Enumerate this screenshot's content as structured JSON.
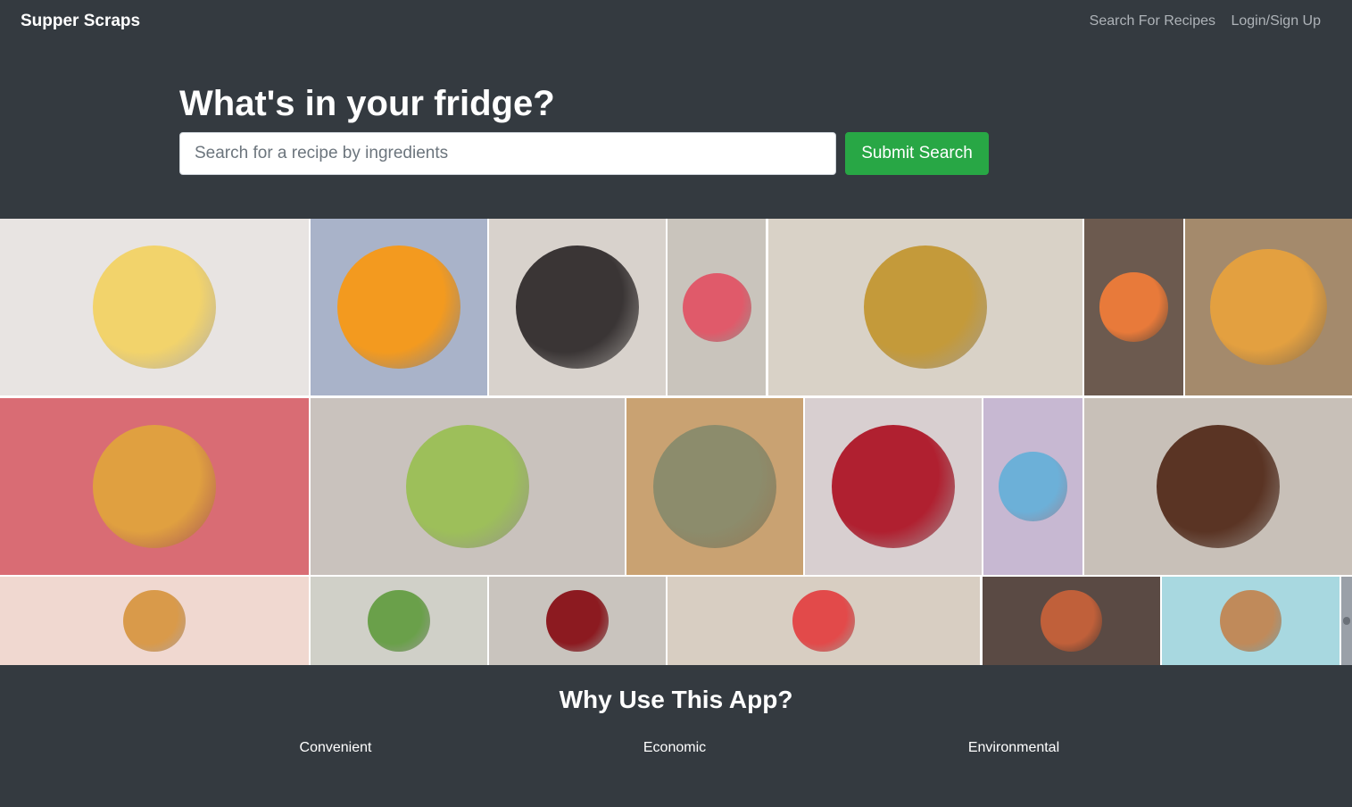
{
  "navbar": {
    "brand": "Supper Scraps",
    "links": [
      "Search For Recipes",
      "Login/Sign Up"
    ]
  },
  "hero": {
    "title": "What's in your fridge?",
    "search_placeholder": "Search for a recipe by ingredients",
    "submit_label": "Submit Search"
  },
  "gallery": {
    "photos": [
      {
        "name": "rainbow-cake-photo",
        "bg": "#e8e4e2",
        "accent": "#f2d36b"
      },
      {
        "name": "orange-cake-photo",
        "bg": "#a9b3c9",
        "accent": "#f39a1f"
      },
      {
        "name": "knots-photo",
        "bg": "#d8d2cc",
        "accent": "#3a3535"
      },
      {
        "name": "strawberry-cake-photo",
        "bg": "#c9c4bc",
        "accent": "#e05a6a"
      },
      {
        "name": "fries-photo",
        "bg": "#d9d2c7",
        "accent": "#c49a3a"
      },
      {
        "name": "cupcake-photo",
        "bg": "#6c5a4f",
        "accent": "#e87a3a"
      },
      {
        "name": "orange-tart-photo",
        "bg": "#a48a6c",
        "accent": "#e3a040"
      },
      {
        "name": "burger-photo",
        "bg": "#d96c74",
        "accent": "#e0a040"
      },
      {
        "name": "tacos-photo",
        "bg": "#c9c2bd",
        "accent": "#9dbf5a"
      },
      {
        "name": "roast-photo",
        "bg": "#c9a272",
        "accent": "#8c8c6c"
      },
      {
        "name": "red-velvet-photo",
        "bg": "#d8cfd0",
        "accent": "#b02030"
      },
      {
        "name": "cake-balls-photo",
        "bg": "#c7b8d2",
        "accent": "#6cb0d8"
      },
      {
        "name": "chocolate-muffins-photo",
        "bg": "#c8c0b8",
        "accent": "#5a3424"
      },
      {
        "name": "sliders-photo",
        "bg": "#f0d8d0",
        "accent": "#d99a4a"
      },
      {
        "name": "salad-photo",
        "bg": "#d0d0c8",
        "accent": "#6aa04a"
      },
      {
        "name": "cherries-photo",
        "bg": "#c9c4be",
        "accent": "#8c1a20"
      },
      {
        "name": "watermelon-photo",
        "bg": "#d8cec2",
        "accent": "#e24a4a"
      },
      {
        "name": "rose-pastry-photo",
        "bg": "#5a4a44",
        "accent": "#c0603a"
      },
      {
        "name": "cookies-photo",
        "bg": "#a8d8e0",
        "accent": "#c08a5a"
      },
      {
        "name": "extra-photo",
        "bg": "#9aa0a8",
        "accent": "#6a7078"
      }
    ]
  },
  "why": {
    "title": "Why Use This App?",
    "features": [
      "Convenient",
      "Economic",
      "Environmental"
    ]
  }
}
